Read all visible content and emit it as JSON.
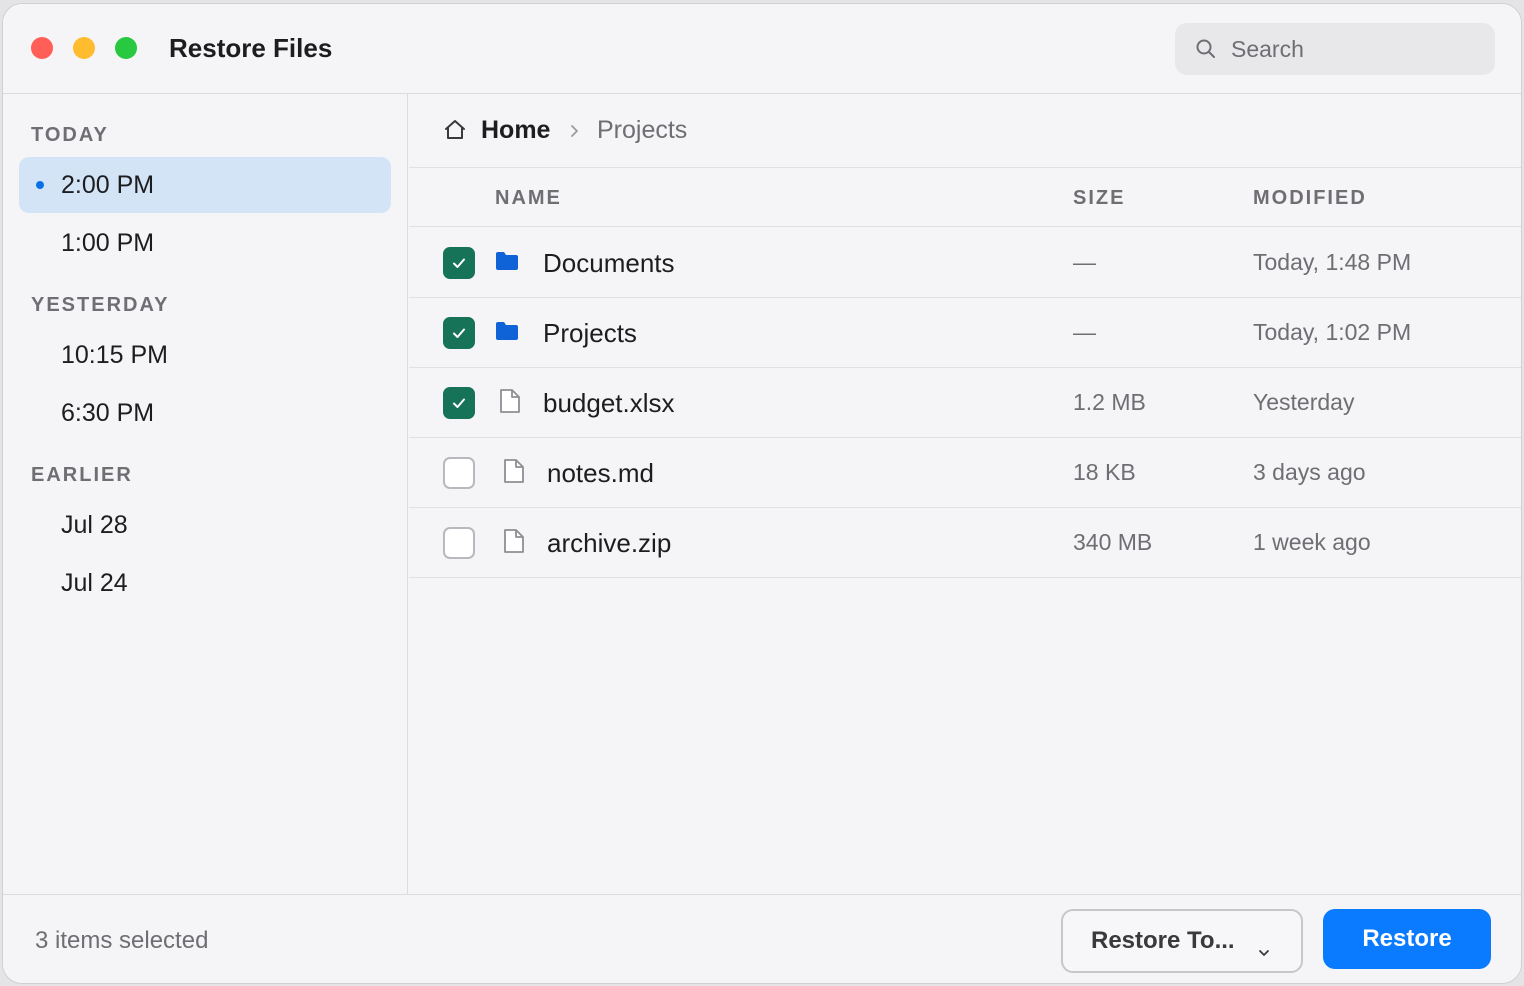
{
  "window": {
    "title": "Restore Files"
  },
  "search": {
    "placeholder": "Search",
    "value": ""
  },
  "colors": {
    "accent": "#0a7aff",
    "check": "#167358",
    "selected": "#d4e4f7",
    "folder": "#1063d6"
  },
  "sidebar": {
    "sections": [
      {
        "label": "TODAY",
        "items": [
          {
            "label": "2:00 PM",
            "selected": true
          },
          {
            "label": "1:00 PM",
            "selected": false
          }
        ]
      },
      {
        "label": "YESTERDAY",
        "items": [
          {
            "label": "10:15 PM",
            "selected": false
          },
          {
            "label": "6:30 PM",
            "selected": false
          }
        ]
      },
      {
        "label": "EARLIER",
        "items": [
          {
            "label": "Jul 28",
            "selected": false
          },
          {
            "label": "Jul 24",
            "selected": false
          }
        ]
      }
    ]
  },
  "breadcrumb": {
    "home": "Home",
    "current": "Projects"
  },
  "table": {
    "columns": {
      "name": "NAME",
      "size": "SIZE",
      "modified": "MODIFIED"
    },
    "rows": [
      {
        "name": "Documents",
        "size": "—",
        "modified": "Today, 1:48 PM",
        "type": "folder-icon",
        "checked": true
      },
      {
        "name": "Projects",
        "size": "—",
        "modified": "Today, 1:02 PM",
        "type": "folder-icon",
        "checked": true
      },
      {
        "name": "budget.xlsx",
        "size": "1.2 MB",
        "modified": "Yesterday",
        "type": "file-icon",
        "checked": true
      },
      {
        "name": "notes.md",
        "size": "18 KB",
        "modified": "3 days ago",
        "type": "file-icon",
        "checked": false
      },
      {
        "name": "archive.zip",
        "size": "340 MB",
        "modified": "1 week ago",
        "type": "file-icon",
        "checked": false
      }
    ]
  },
  "footer": {
    "status": "3 items selected",
    "restore_to_label": "Restore To...",
    "restore_label": "Restore"
  }
}
